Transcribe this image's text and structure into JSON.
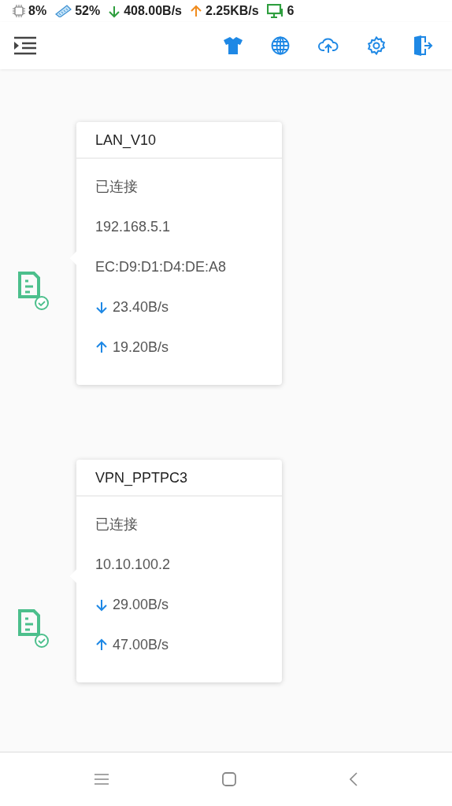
{
  "status_bar": [
    {
      "kind": "cpu",
      "text": "8%"
    },
    {
      "kind": "ram",
      "text": "52%"
    },
    {
      "kind": "down",
      "text": "408.00B/s"
    },
    {
      "kind": "up",
      "text": "2.25KB/s"
    },
    {
      "kind": "devices",
      "text": "6"
    }
  ],
  "interfaces": [
    {
      "name": "LAN_V10",
      "connected": true,
      "lines": [
        {
          "kind": "text",
          "text": "已连接"
        },
        {
          "kind": "text",
          "text": "192.168.5.1"
        },
        {
          "kind": "text",
          "text": "EC:D9:D1:D4:DE:A8"
        },
        {
          "kind": "down",
          "text": "23.40B/s"
        },
        {
          "kind": "up",
          "text": "19.20B/s"
        }
      ]
    },
    {
      "name": "VPN_PPTPC3",
      "connected": true,
      "lines": [
        {
          "kind": "text",
          "text": "已连接"
        },
        {
          "kind": "text",
          "text": "10.10.100.2"
        },
        {
          "kind": "down",
          "text": "29.00B/s"
        },
        {
          "kind": "up",
          "text": "47.00B/s"
        }
      ]
    }
  ]
}
